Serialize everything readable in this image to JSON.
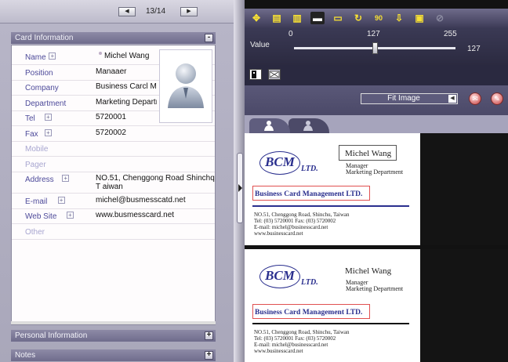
{
  "pager": {
    "prev": "◀",
    "next": "▶",
    "count": "13/14"
  },
  "card_info": {
    "title": "Card Information",
    "toggle": "-",
    "fields": [
      {
        "label": "Name",
        "value": "Michel Wang",
        "expandable": true,
        "dim": false
      },
      {
        "label": "Position",
        "value": "Manaaer",
        "expandable": false,
        "dim": false
      },
      {
        "label": "Company",
        "value": "Business Carcl Ma",
        "expandable": false,
        "dim": false
      },
      {
        "label": "Department",
        "value": "Marketing Departn",
        "expandable": false,
        "dim": false
      },
      {
        "label": "Tel",
        "value": "5720001",
        "expandable": true,
        "dim": false
      },
      {
        "label": "Fax",
        "value": "5720002",
        "expandable": true,
        "dim": false
      },
      {
        "label": "Mobile",
        "value": "",
        "expandable": false,
        "dim": true
      },
      {
        "label": "Pager",
        "value": "",
        "expandable": false,
        "dim": true
      },
      {
        "label": "Address",
        "value": "NO.51, Chenggong Road Shinchq T aiwan",
        "expandable": true,
        "dim": false
      },
      {
        "label": "E-mail",
        "value": "michel@busmesscatd.net",
        "expandable": true,
        "dim": false
      },
      {
        "label": "Web Site",
        "value": "www.busmesscard.net",
        "expandable": true,
        "dim": false
      },
      {
        "label": "Other",
        "value": "",
        "expandable": false,
        "dim": true
      }
    ]
  },
  "personal_info": {
    "title": "Personal Information",
    "toggle": "+"
  },
  "notes": {
    "title": "Notes",
    "toggle": "+"
  },
  "toolbar": {
    "icons": [
      "move-icon",
      "scan-icon",
      "layout-icon",
      "crop-icon",
      "display-icon",
      "rotate-icon",
      "rotate-90-icon",
      "tray-icon",
      "save-icon",
      "link-icon"
    ],
    "glyphs": [
      "✥",
      "▤",
      "▥",
      "▬",
      "▭",
      "↻",
      "90",
      "⇩",
      "▣",
      "⊘"
    ],
    "accent": "#f7e034"
  },
  "value_slider": {
    "label": "Value",
    "min": "0",
    "mid": "127",
    "max": "255",
    "current": "127",
    "fraction": 0.5
  },
  "fit": {
    "selected": "Fit Image"
  },
  "card_front": {
    "logo": "BCM",
    "ltd": "LTD.",
    "name": "Michel Wang",
    "position": "Manager",
    "department": "Marketing Department",
    "company": "Business Card Management  LTD.",
    "address": "NO.51, Chenggong Road, Shinchu, Taiwan",
    "telfax": "Tel: (03) 5720001      Fax: (03) 5720002",
    "email": "E-mail: michel@businesscard.net",
    "web": "www.businesscard.net"
  },
  "card_back": {
    "logo": "BCM",
    "ltd": "LTD.",
    "name": "Michel Wang",
    "position": "Manager",
    "department": "Marketing Department",
    "company": "Business Card Management  LTD.",
    "address": "NO.51, Chenggong Road, Shinchu, Taiwan",
    "telfax": "Tel: (03) 5720001      Fax: (03) 5720002",
    "email": "E-mail: michel@businesscard.net",
    "web": "www.businesscard.net"
  },
  "colors": {
    "label": "#4d4a9a",
    "header": "#7a7796",
    "highlight": "#e05050",
    "brand": "#2a2f8e"
  }
}
